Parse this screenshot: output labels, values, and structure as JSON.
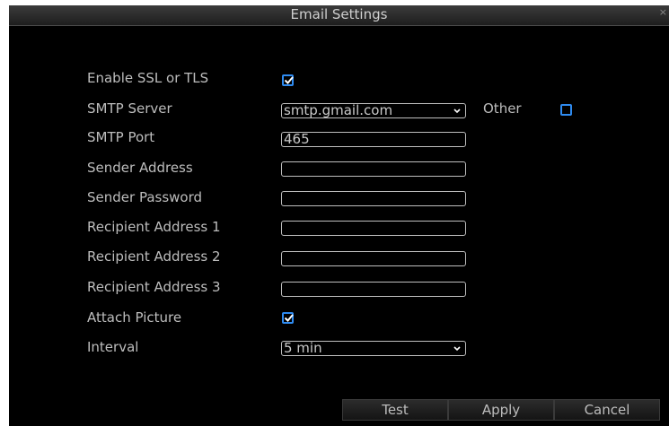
{
  "window": {
    "title": "Email Settings",
    "close": "×"
  },
  "form": {
    "enable_ssl": {
      "label": "Enable SSL or TLS",
      "checked": true
    },
    "smtp_server": {
      "label": "SMTP Server",
      "value": "smtp.gmail.com",
      "other_label": "Other",
      "other_checked": false
    },
    "smtp_port": {
      "label": "SMTP Port",
      "value": "465"
    },
    "sender_address": {
      "label": "Sender Address",
      "value": ""
    },
    "sender_password": {
      "label": "Sender Password",
      "value": ""
    },
    "recipient_1": {
      "label": "Recipient Address 1",
      "value": ""
    },
    "recipient_2": {
      "label": "Recipient Address 2",
      "value": ""
    },
    "recipient_3": {
      "label": "Recipient Address 3",
      "value": ""
    },
    "attach_picture": {
      "label": "Attach Picture",
      "checked": true
    },
    "interval": {
      "label": "Interval",
      "value": "5 min"
    }
  },
  "buttons": {
    "test": "Test",
    "apply": "Apply",
    "cancel": "Cancel"
  },
  "colors": {
    "accent": "#2f8bf0",
    "background": "#000000",
    "text": "#bdbdbd"
  },
  "icons": {
    "checkmark": "checkmark-icon",
    "dropdown": "chevron-down-icon"
  }
}
